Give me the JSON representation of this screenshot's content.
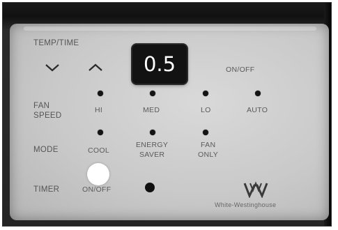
{
  "display": {
    "value": "0.5"
  },
  "labels": {
    "temp_time": "TEMP/TIME",
    "on_off_top": "ON/OFF",
    "fan": "FAN",
    "speed": "SPEED",
    "mode": "MODE",
    "timer": "TIMER"
  },
  "fan_speed_options": [
    "HI",
    "MED",
    "LO",
    "AUTO"
  ],
  "mode_options": [
    {
      "line1": "COOL",
      "line2": ""
    },
    {
      "line1": "ENERGY",
      "line2": "SAVER"
    },
    {
      "line1": "FAN",
      "line2": "ONLY"
    }
  ],
  "timer_on_off": "ON/OFF",
  "brand": "White-Westinghouse",
  "icons": [
    "chevron-down-icon",
    "chevron-up-icon",
    "white-westinghouse-logo"
  ],
  "colors": {
    "panel": "#cfcfcf",
    "display_bg": "#121212",
    "display_text": "#ffffff",
    "led": "#141414"
  }
}
